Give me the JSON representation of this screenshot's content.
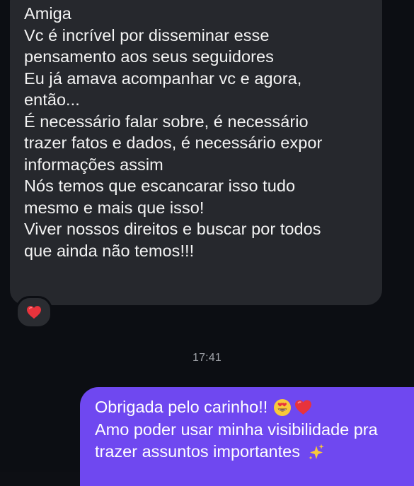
{
  "received_message": {
    "lines": [
      "Amiga",
      "Vc é incrível por disseminar esse",
      "pensamento aos seus seguidores",
      "Eu já amava acompanhar vc e agora,",
      "então...",
      "É necessário falar sobre, é necessário",
      "trazer fatos e dados, é necessário expor",
      "informações assim",
      "Nós temos que escancarar isso tudo",
      "mesmo e mais que isso!",
      "Viver nossos direitos e buscar por todos",
      "que ainda não temos!!!"
    ],
    "reaction_icon": "red-heart"
  },
  "timestamp": "17:41",
  "sent_message": {
    "line1": "Obrigada pelo carinho!!",
    "line1_emojis": [
      "heart-eyes-face",
      "red-heart"
    ],
    "line2": "Amo poder usar minha visibilidade pra",
    "line3": "trazer assuntos importantes",
    "line3_emoji": "sparkles"
  },
  "colors": {
    "background": "#0c0e13",
    "received_bubble": "#26282d",
    "sent_bubble": "#6f48f0",
    "timestamp": "#9ea1a7",
    "heart": "#e8333c"
  }
}
